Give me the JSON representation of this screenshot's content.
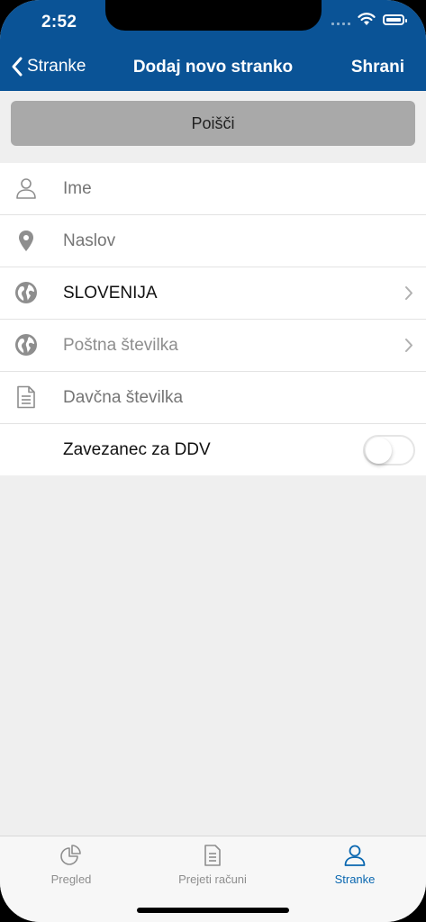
{
  "status": {
    "time": "2:52"
  },
  "nav": {
    "back_label": "Stranke",
    "title": "Dodaj novo stranko",
    "save_label": "Shrani"
  },
  "search": {
    "label": "Poišči"
  },
  "form": {
    "name_placeholder": "Ime",
    "address_placeholder": "Naslov",
    "country_value": "SLOVENIJA",
    "postal_placeholder": "Poštna številka",
    "tax_placeholder": "Davčna številka",
    "vat_label": "Zavezanec za DDV",
    "vat_enabled": false
  },
  "tabs": [
    {
      "label": "Pregled",
      "icon": "pie-chart-icon",
      "active": false
    },
    {
      "label": "Prejeti računi",
      "icon": "document-icon",
      "active": false
    },
    {
      "label": "Stranke",
      "icon": "person-icon",
      "active": true
    }
  ],
  "colors": {
    "header": "#0a5396",
    "accent": "#0a67b0",
    "search_button": "#a9a9a9"
  }
}
